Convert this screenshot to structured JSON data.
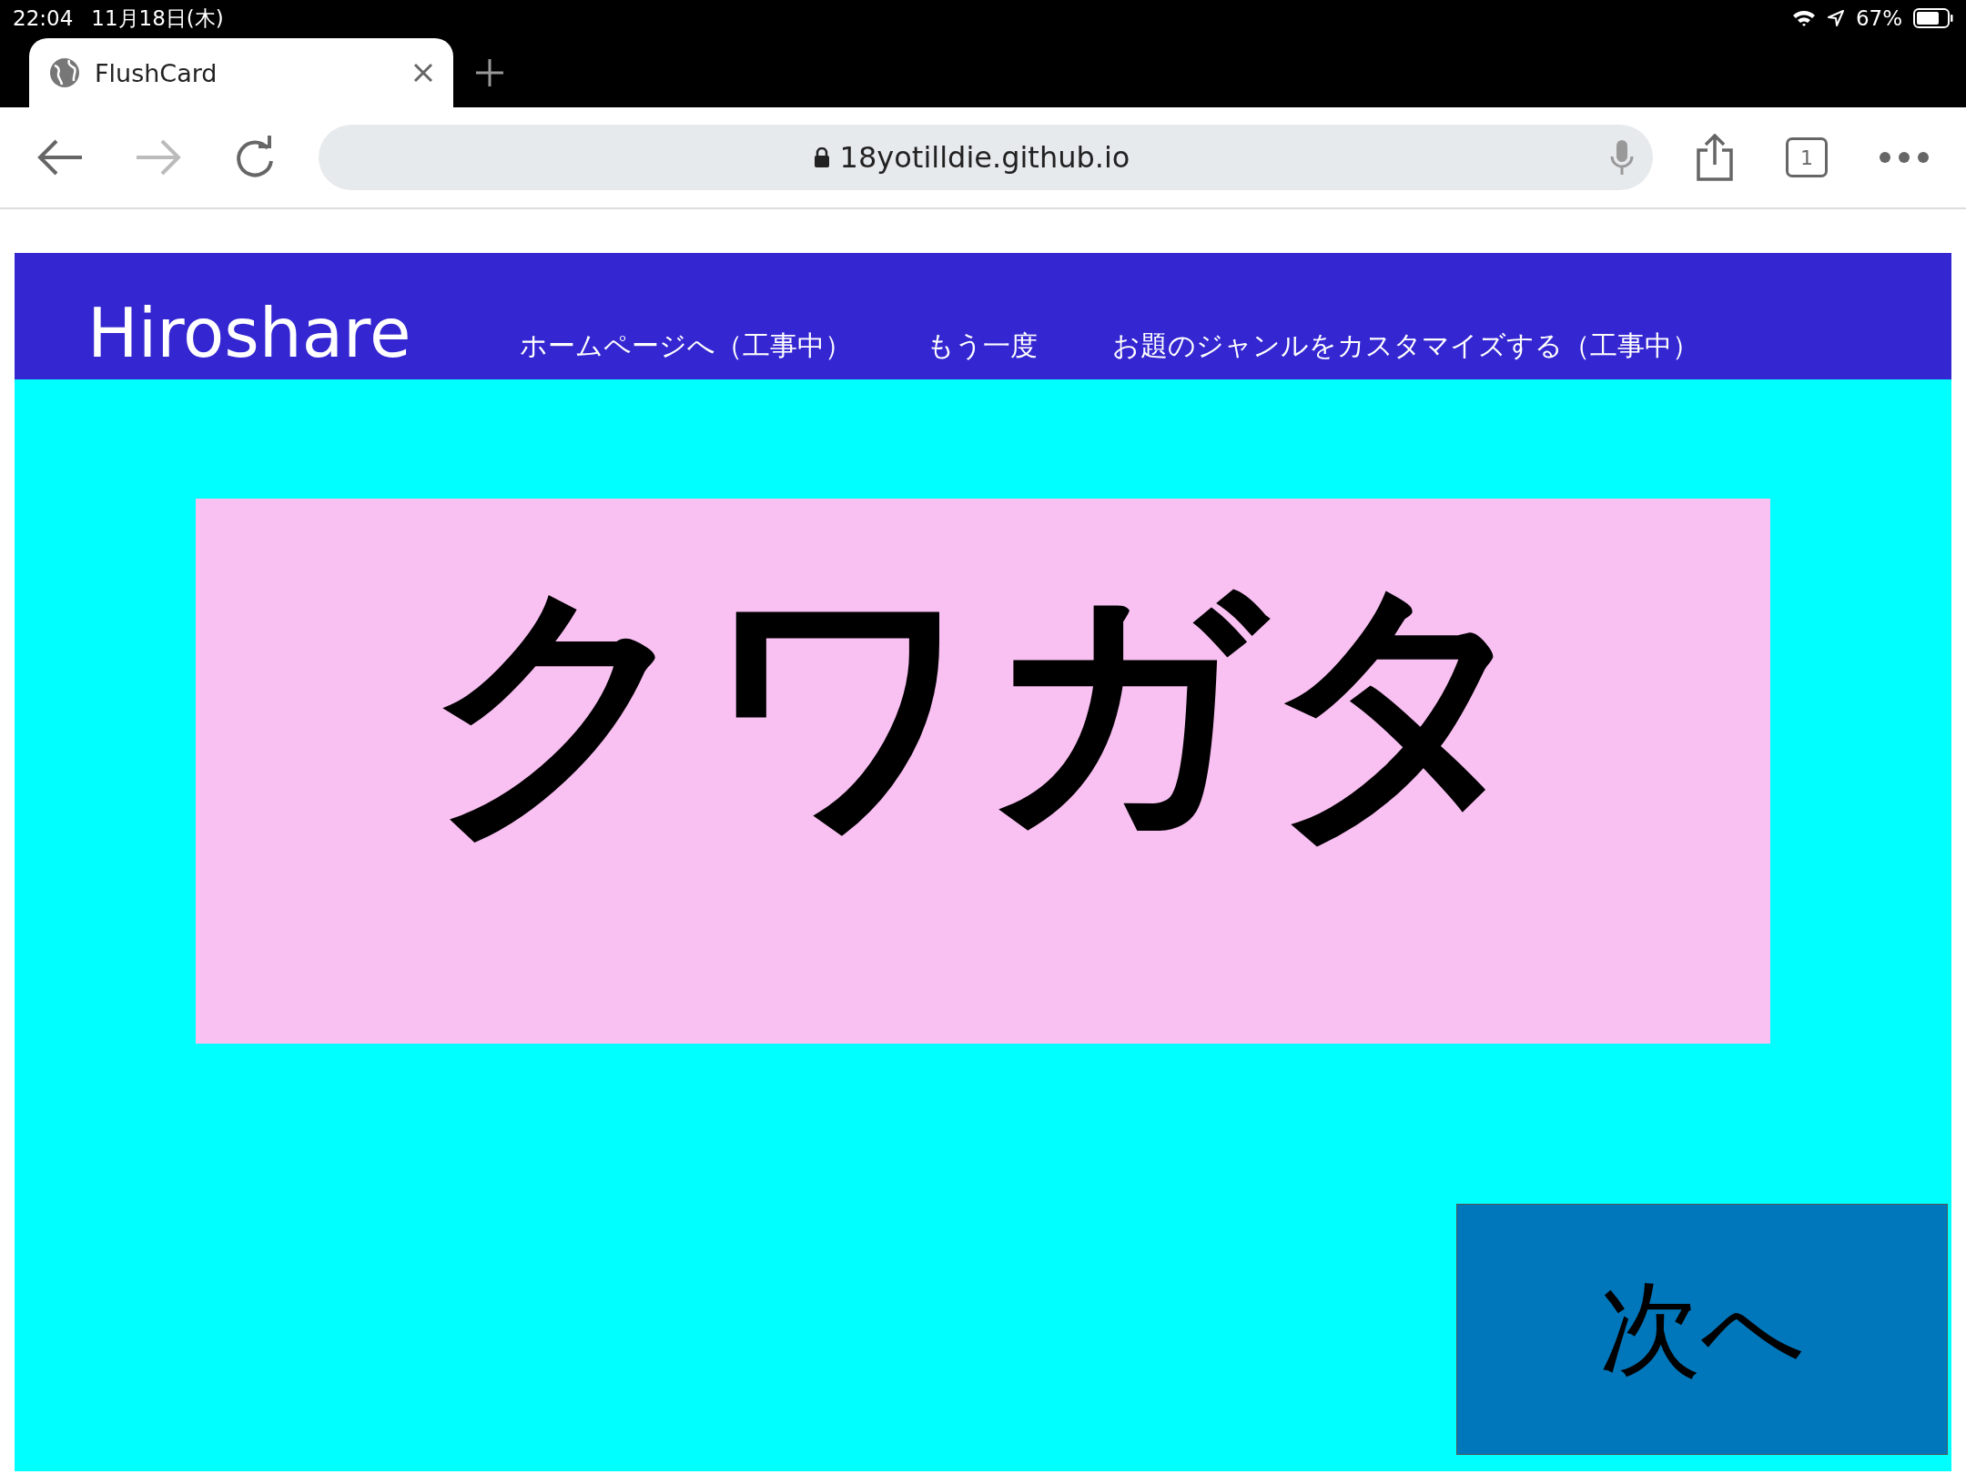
{
  "status_bar": {
    "time": "22:04",
    "date": "11月18日(木)",
    "battery": "67%"
  },
  "tabs": [
    {
      "title": "FlushCard",
      "selected": true
    }
  ],
  "toolbar": {
    "url": "18yotilldie.github.io",
    "tab_count": "1"
  },
  "nav": {
    "brand": "Hiroshare",
    "links": [
      "ホームページへ（工事中）",
      "もう一度",
      "お題のジャンルをカスタマイズする（工事中）"
    ]
  },
  "card": {
    "word": "クワガタ"
  },
  "next_button": {
    "label": "次へ"
  }
}
